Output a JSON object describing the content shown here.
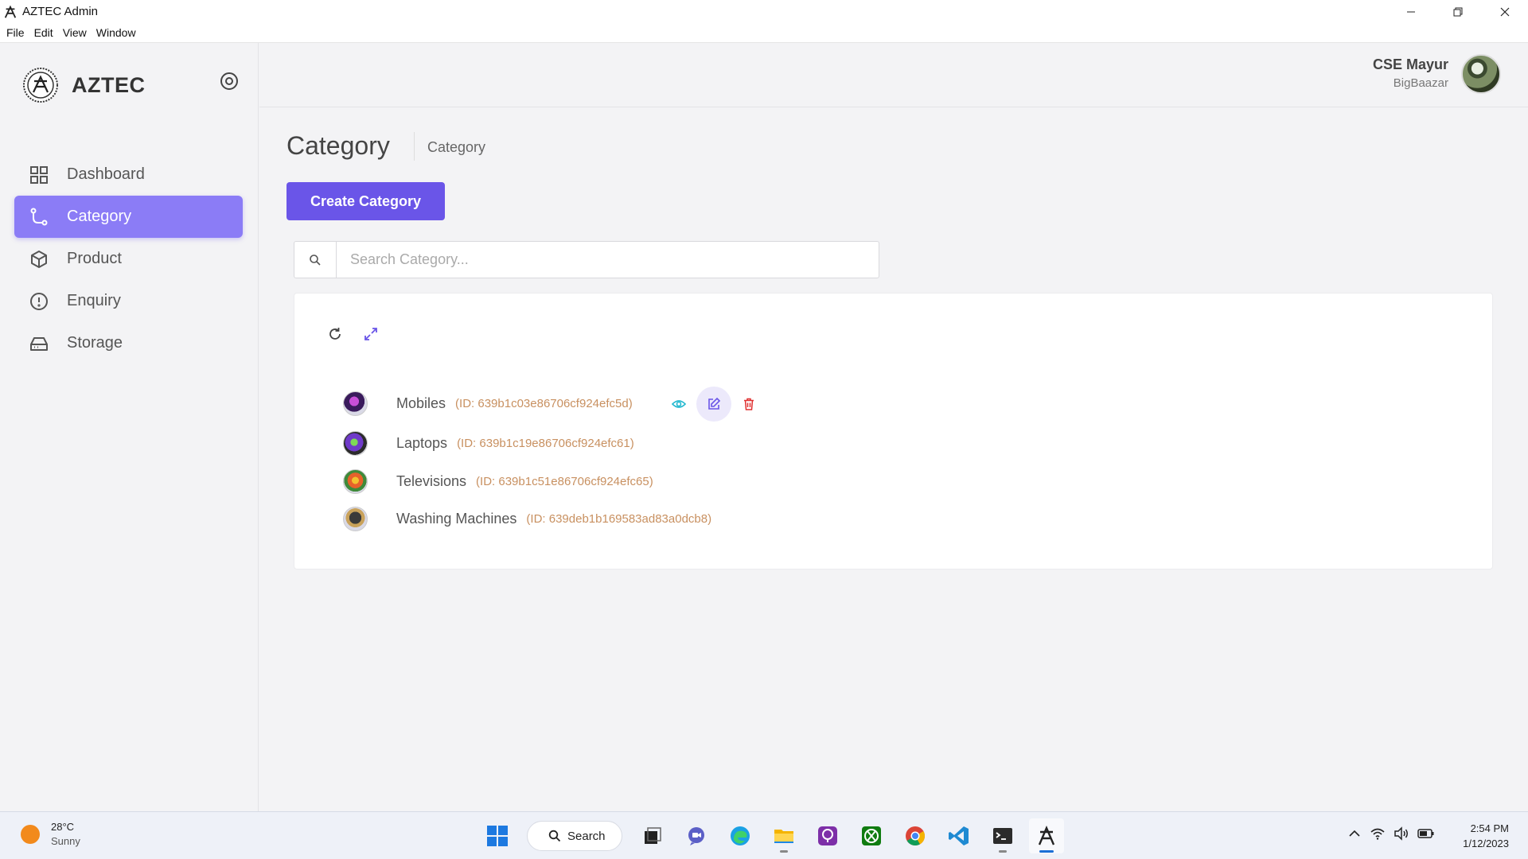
{
  "window": {
    "title": "AZTEC Admin",
    "menu": [
      "File",
      "Edit",
      "View",
      "Window"
    ]
  },
  "sidebar": {
    "brand": "AZTEC",
    "items": [
      {
        "label": "Dashboard",
        "icon": "grid-icon",
        "active": false
      },
      {
        "label": "Category",
        "icon": "branch-icon",
        "active": true
      },
      {
        "label": "Product",
        "icon": "box-icon",
        "active": false
      },
      {
        "label": "Enquiry",
        "icon": "info-icon",
        "active": false
      },
      {
        "label": "Storage",
        "icon": "hard-drive-icon",
        "active": false
      }
    ]
  },
  "header": {
    "user_name": "CSE Mayur",
    "user_org": "BigBaazar"
  },
  "main": {
    "title": "Category",
    "breadcrumb": "Category",
    "create_button": "Create Category",
    "search_placeholder": "Search Category...",
    "categories": [
      {
        "name": "Mobiles",
        "id": "(ID: 639b1c03e86706cf924efc5d)"
      },
      {
        "name": "Laptops",
        "id": "(ID: 639b1c19e86706cf924efc61)"
      },
      {
        "name": "Televisions",
        "id": "(ID: 639b1c51e86706cf924efc65)"
      },
      {
        "name": "Washing Machines",
        "id": "(ID: 639deb1b169583ad83a0dcb8)"
      }
    ]
  },
  "taskbar": {
    "temperature": "28°C",
    "condition": "Sunny",
    "search_label": "Search",
    "time": "2:54 PM",
    "date": "1/12/2023"
  },
  "colors": {
    "accent": "#6a55e8",
    "active_nav": "#8b7cf6",
    "id_text": "#c89060",
    "view_icon": "#22b8cf",
    "delete_icon": "#e03131"
  }
}
